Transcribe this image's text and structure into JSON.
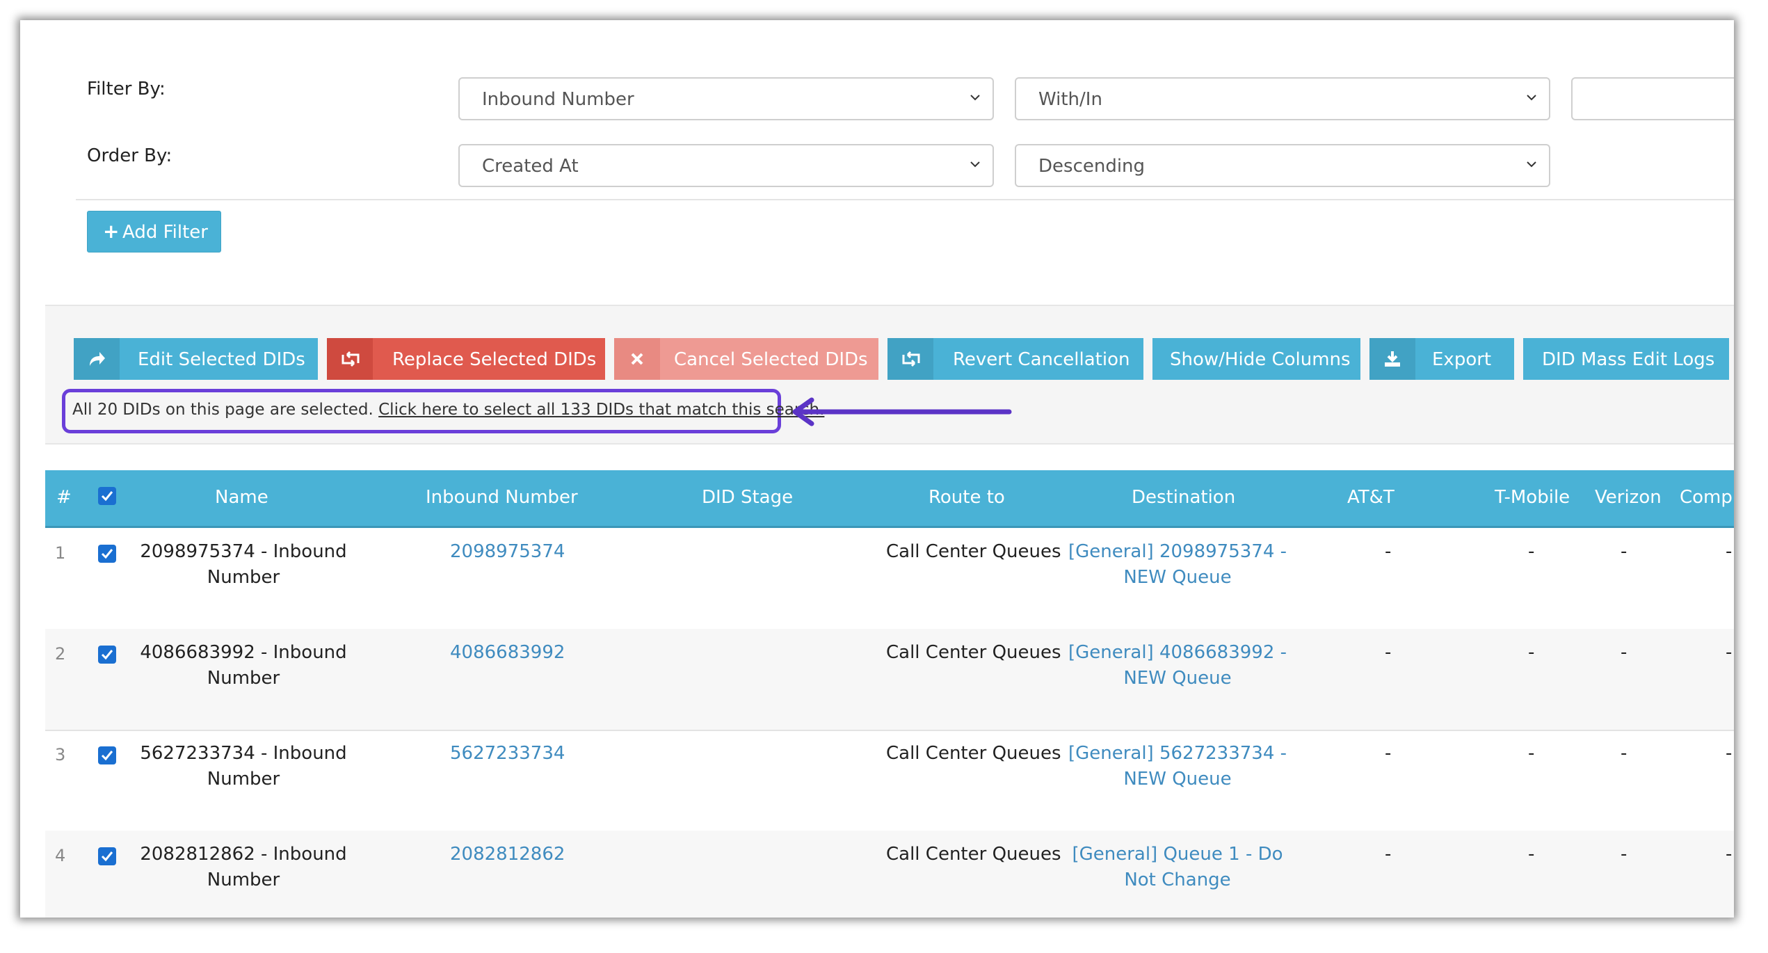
{
  "filters": {
    "filter_by_label": "Filter By:",
    "order_by_label": "Order By:",
    "filter_field": "Inbound Number",
    "filter_operator": "With/In",
    "filter_value": "",
    "order_field": "Created At",
    "order_direction": "Descending",
    "add_filter_label": "Add Filter"
  },
  "actions": {
    "edit_selected": "Edit Selected DIDs",
    "replace_selected": "Replace Selected DIDs",
    "cancel_selected": "Cancel Selected DIDs",
    "revert_cancellation": "Revert Cancellation",
    "show_hide_columns": "Show/Hide Columns",
    "export": "Export",
    "mass_edit_logs": "DID Mass Edit Logs"
  },
  "selection": {
    "message": "All 20 DIDs on this page are selected.",
    "select_all_link": "Click here to select all 133 DIDs that match this search."
  },
  "colors": {
    "header": "#4ab2d6",
    "replace": "#e05a4e",
    "cancel": "#ee9a93",
    "highlight": "#6a3fd9",
    "link": "#3f8bbf"
  },
  "table": {
    "columns": {
      "num": "#",
      "name": "Name",
      "inbound": "Inbound Number",
      "stage": "DID Stage",
      "route": "Route to",
      "destination": "Destination",
      "att": "AT&T",
      "tmobile": "T-Mobile",
      "verizon": "Verizon",
      "complaint": "Complai"
    },
    "rows": [
      {
        "num": "1",
        "name_l1": "2098975374 - Inbound",
        "name_l2": "Number",
        "inbound": "2098975374",
        "stage": "",
        "route": "Call Center Queues",
        "dest_l1": "[General] 2098975374 -",
        "dest_l2": "NEW Queue",
        "att": "-",
        "tmobile": "-",
        "verizon": "-",
        "complaint": "-"
      },
      {
        "num": "2",
        "name_l1": "4086683992 - Inbound",
        "name_l2": "Number",
        "inbound": "4086683992",
        "stage": "",
        "route": "Call Center Queues",
        "dest_l1": "[General] 4086683992 -",
        "dest_l2": "NEW Queue",
        "att": "-",
        "tmobile": "-",
        "verizon": "-",
        "complaint": "-"
      },
      {
        "num": "3",
        "name_l1": "5627233734 - Inbound",
        "name_l2": "Number",
        "inbound": "5627233734",
        "stage": "",
        "route": "Call Center Queues",
        "dest_l1": "[General] 5627233734 -",
        "dest_l2": "NEW Queue",
        "att": "-",
        "tmobile": "-",
        "verizon": "-",
        "complaint": "-"
      },
      {
        "num": "4",
        "name_l1": "2082812862 - Inbound",
        "name_l2": "Number",
        "inbound": "2082812862",
        "stage": "",
        "route": "Call Center Queues",
        "dest_l1": "[General] Queue 1 - Do",
        "dest_l2": "Not Change",
        "att": "-",
        "tmobile": "-",
        "verizon": "-",
        "complaint": "-"
      }
    ]
  }
}
